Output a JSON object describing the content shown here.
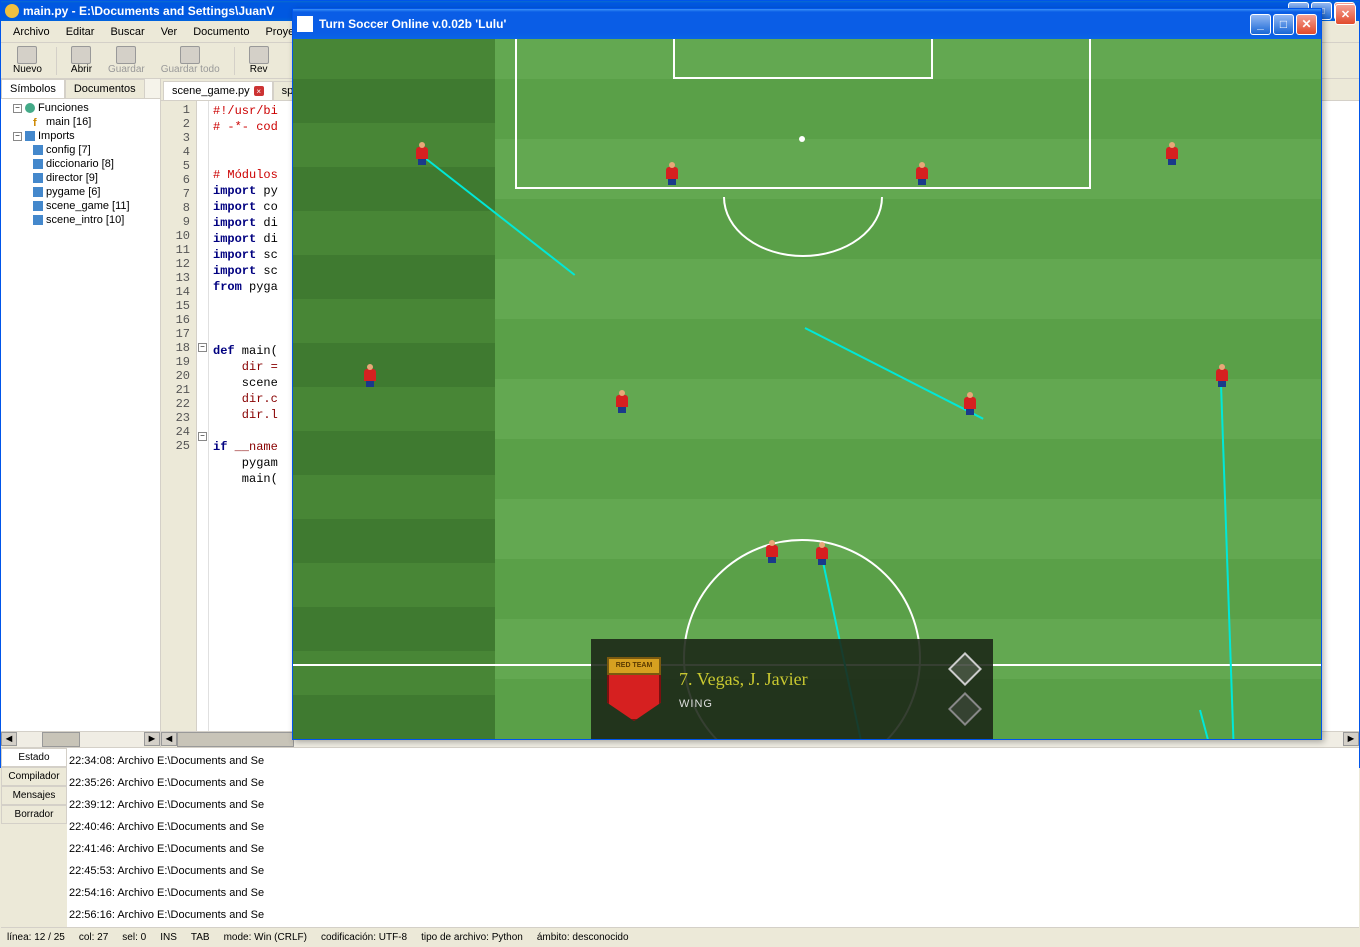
{
  "editor": {
    "title": "main.py - E:\\Documents and Settings\\JuanV",
    "menu": [
      "Archivo",
      "Editar",
      "Buscar",
      "Ver",
      "Documento",
      "Proyecto"
    ],
    "toolbar": {
      "nuevo": "Nuevo",
      "abrir": "Abrir",
      "guardar": "Guardar",
      "guardar_todo": "Guardar todo",
      "rev": "Rev"
    },
    "side_tabs": {
      "simbolos": "Símbolos",
      "documentos": "Documentos"
    },
    "tree": {
      "funciones": "Funciones",
      "main_item": "main [16]",
      "imports": "Imports",
      "items": [
        "config [7]",
        "diccionario [8]",
        "director [9]",
        "pygame [6]",
        "scene_game [11]",
        "scene_intro [10]"
      ]
    },
    "tabs": {
      "scene_game": "scene_game.py",
      "sp": "sp_i"
    },
    "lines": [
      "1",
      "2",
      "3",
      "4",
      "5",
      "6",
      "7",
      "8",
      "9",
      "10",
      "11",
      "12",
      "13",
      "14",
      "15",
      "16",
      "17",
      "18",
      "19",
      "20",
      "21",
      "22",
      "23",
      "24",
      "25"
    ],
    "code": {
      "l1": "#!/usr/bi",
      "l2": "# -*- cod",
      "l5": "# Módulos",
      "l6": "import",
      "l6b": " py",
      "l7": "import",
      "l7b": " co",
      "l8": "import",
      "l8b": " di",
      "l9": "import",
      "l9b": " di",
      "l10": "import",
      "l10b": " sc",
      "l11": "import",
      "l11b": " sc",
      "l12a": "from",
      "l12b": " pyga",
      "l16a": "def",
      "l16b": " main(",
      "l17": "    dir =",
      "l18": "    scene",
      "l19": "    dir.c",
      "l20": "    dir.l",
      "l22a": "if",
      "l22b": " __name",
      "l23": "    pygam",
      "l24": "    main("
    },
    "msg_tabs": {
      "estado": "Estado",
      "compilador": "Compilador",
      "mensajes": "Mensajes",
      "borrador": "Borrador"
    },
    "messages": [
      "22:34:08: Archivo E:\\Documents and Se",
      "22:35:26: Archivo E:\\Documents and Se",
      "22:39:12: Archivo E:\\Documents and Se",
      "22:40:46: Archivo E:\\Documents and Se",
      "22:41:46: Archivo E:\\Documents and Se",
      "22:45:53: Archivo E:\\Documents and Se",
      "22:54:16: Archivo E:\\Documents and Se",
      "22:56:16: Archivo E:\\Documents and Se"
    ],
    "status": {
      "linea": "línea: 12 / 25",
      "col": "col: 27",
      "sel": "sel: 0",
      "ins": "INS",
      "tab": "TAB",
      "mode": "mode: Win (CRLF)",
      "enc": "codificación: UTF-8",
      "ftype": "tipo de archivo: Python",
      "scope": "ámbito: desconocido"
    }
  },
  "game": {
    "title": "Turn Soccer Online v.0.02b 'Lulu'",
    "badge_label": "RED TEAM",
    "player_name": "7. Vegas, J. Javier",
    "position": "WING"
  }
}
